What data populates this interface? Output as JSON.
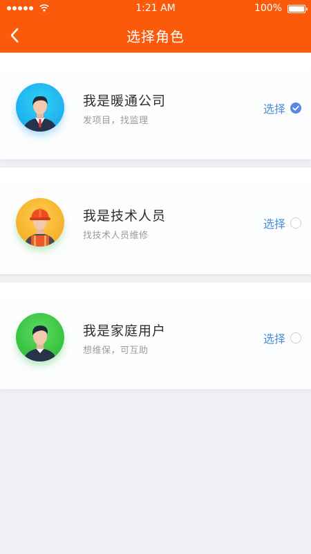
{
  "status_bar": {
    "time": "1:21 AM",
    "battery": "100%"
  },
  "header": {
    "title": "选择角色"
  },
  "roles": [
    {
      "title": "我是暖通公司",
      "desc": "发项目，找监理",
      "select_label": "选择",
      "selected": true
    },
    {
      "title": "我是技术人员",
      "desc": "找技术人员维修",
      "select_label": "选择",
      "selected": false
    },
    {
      "title": "我是家庭用户",
      "desc": "想维保，可互助",
      "select_label": "选择",
      "selected": false
    }
  ],
  "colors": {
    "header": "#fb5a0b",
    "accent": "#4a8ddc",
    "check": "#5b86e5",
    "background": "#eef0f4"
  },
  "icons": [
    "back-chevron-icon",
    "signal-icon",
    "wifi-icon",
    "battery-icon",
    "business-man-avatar-icon",
    "construction-worker-avatar-icon",
    "home-user-avatar-icon",
    "check-icon"
  ]
}
